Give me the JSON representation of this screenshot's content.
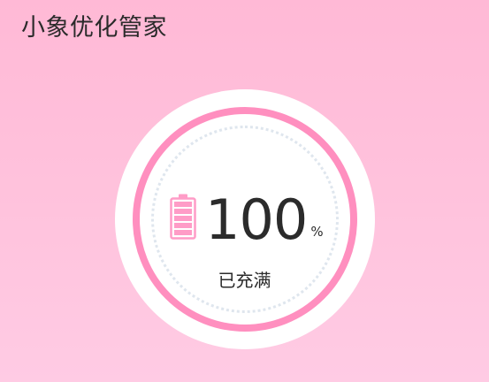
{
  "header": {
    "app_title": "小象优化管家"
  },
  "battery": {
    "level_percent": 100,
    "value_text": "100",
    "unit": "%",
    "status": "已充满",
    "icon": "battery-full-icon"
  },
  "colors": {
    "background_top": "#ffb9d6",
    "background_bottom": "#ffcbe4",
    "ring_accent": "#ff8fbf",
    "dial_face": "#ffffff",
    "text": "#2b2b2b"
  }
}
